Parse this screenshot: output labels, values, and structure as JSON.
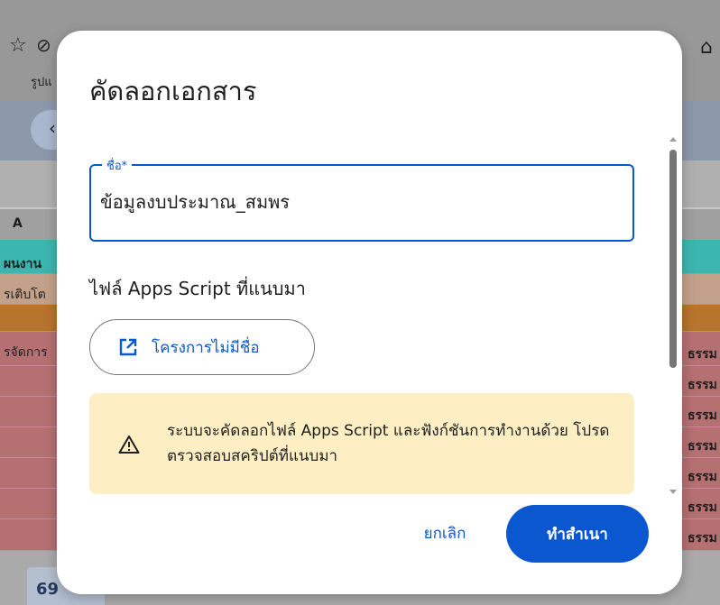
{
  "background": {
    "doc_subtitle_partial": "รูปแ",
    "column_header": "A",
    "cells_left": [
      "ผนงาน",
      "รเติบโต",
      "",
      "รจัดการ"
    ],
    "cells_right": [
      "ธรรม",
      "ธรรม",
      "ธรรม",
      "ธรรม",
      "ธรรม",
      "ธรรม",
      "ธรรม"
    ],
    "row_number": "69",
    "icons": [
      "star-icon",
      "link-icon",
      "home-icon",
      "chevron-left-icon"
    ]
  },
  "dialog": {
    "title": "คัดลอกเอกสาร",
    "name_field": {
      "label": "ชื่อ*",
      "value": "ข้อมูลงบประมาณ_สมพร"
    },
    "attached_heading": "ไฟล์ Apps Script ที่แนบมา",
    "attached_link": {
      "label": "โครงการไม่มีชื่อ",
      "icon": "open-in-new-icon"
    },
    "notice": {
      "icon": "warning-icon",
      "text": "ระบบจะคัดลอกไฟล์ Apps Script และฟังก์ชันการทำงานด้วย โปรดตรวจสอบสคริปต์ที่แนบมา"
    },
    "buttons": {
      "cancel": "ยกเลิก",
      "confirm": "ทำสำเนา"
    }
  },
  "colors": {
    "accent": "#0b57d0",
    "notice_bg": "#fdefc3",
    "row_green": "#3cb6b0",
    "row_tan": "#c2a08a",
    "row_orange": "#b7742c",
    "row_red": "#b57071"
  }
}
